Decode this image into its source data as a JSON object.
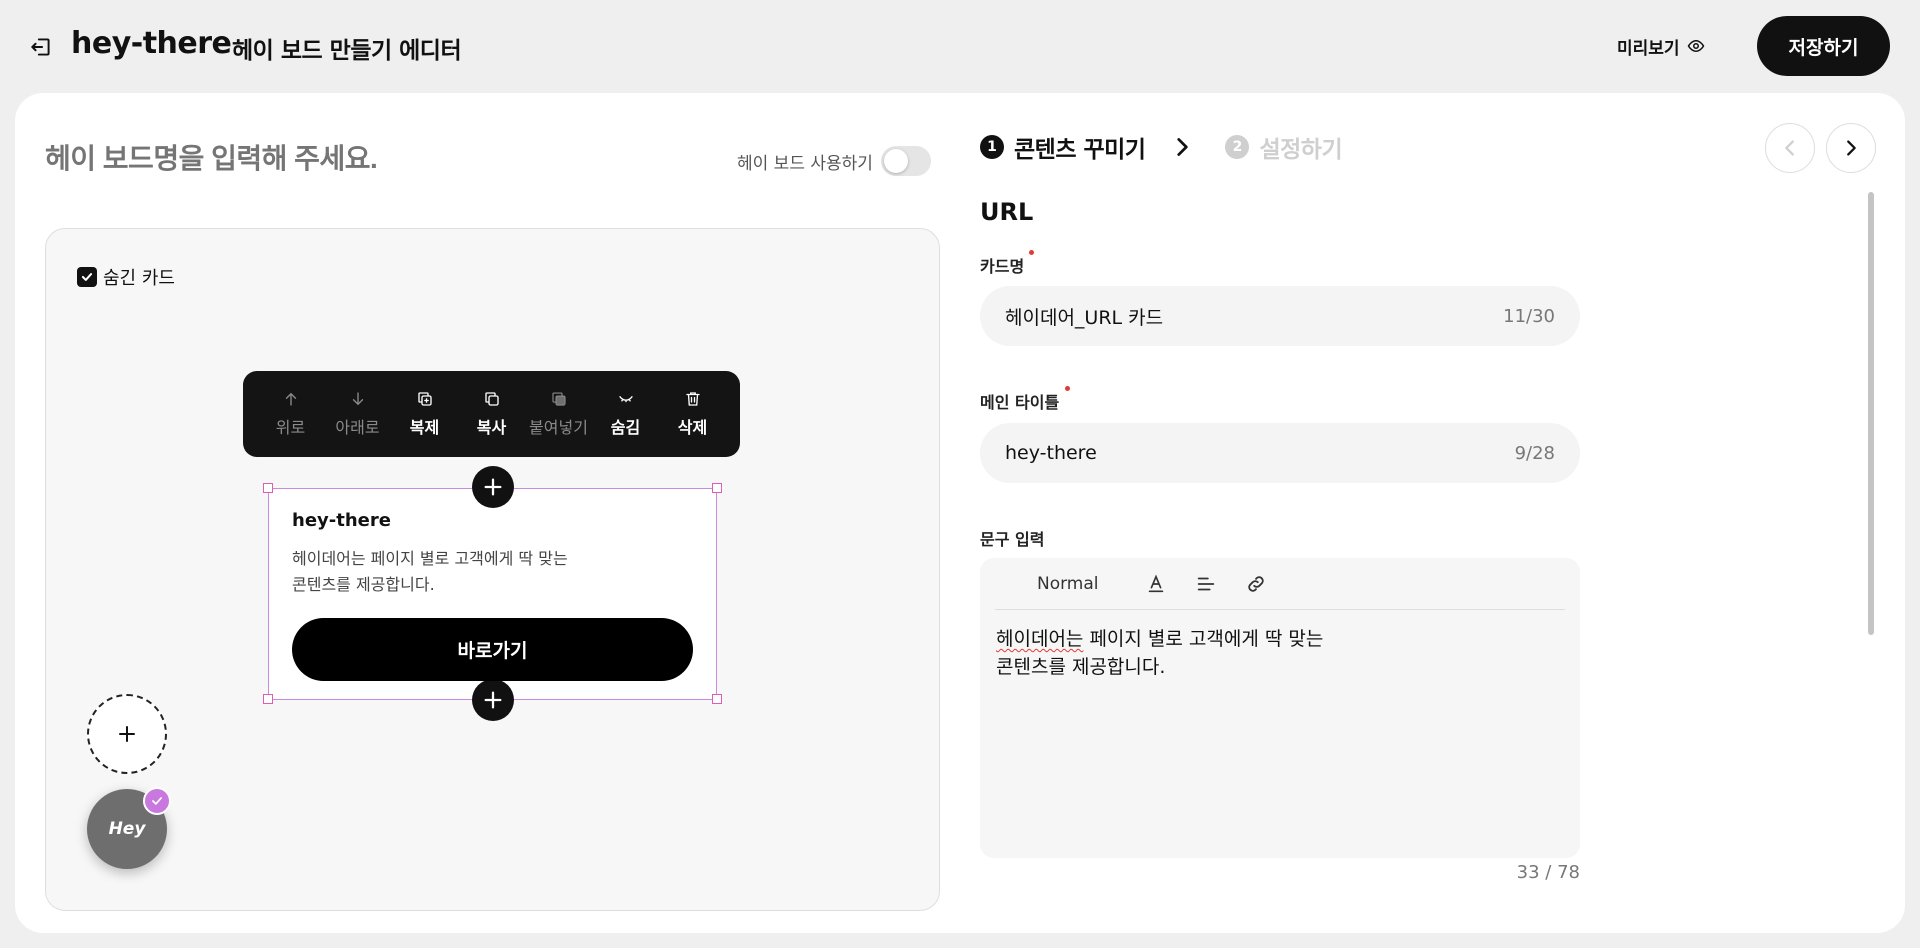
{
  "header": {
    "brand": "hey-there",
    "editor_title": "헤이 보드 만들기 에디터",
    "preview_label": "미리보기",
    "save_label": "저장하기"
  },
  "board": {
    "name_placeholder": "헤이 보드명을 입력해 주세요.",
    "use_label": "헤이 보드 사용하기",
    "use_enabled": false
  },
  "canvas": {
    "hidden_card_label": "숨긴 카드",
    "hidden_card_checked": true,
    "toolbar": [
      {
        "label": "위로",
        "icon": "arrow-up-icon",
        "enabled": false
      },
      {
        "label": "아래로",
        "icon": "arrow-down-icon",
        "enabled": false
      },
      {
        "label": "복제",
        "icon": "duplicate-icon",
        "enabled": true
      },
      {
        "label": "복사",
        "icon": "copy-icon",
        "enabled": true
      },
      {
        "label": "붙여넣기",
        "icon": "paste-icon",
        "enabled": false
      },
      {
        "label": "숨김",
        "icon": "eye-closed-icon",
        "enabled": true
      },
      {
        "label": "삭제",
        "icon": "trash-icon",
        "enabled": true
      }
    ],
    "card": {
      "title": "hey-there",
      "body": "헤이데어는 페이지 별로 고객에게 딱 맞는\n콘텐츠를 제공합니다.",
      "button_label": "바로가기"
    },
    "avatar_label": "Hey"
  },
  "steps": [
    {
      "number": "1",
      "label": "콘텐츠 꾸미기",
      "active": true
    },
    {
      "number": "2",
      "label": "설정하기",
      "active": false
    }
  ],
  "form": {
    "section_title": "URL",
    "card_name": {
      "label": "카드명",
      "value": "헤이데어_URL 카드",
      "count": "11/30"
    },
    "main_title": {
      "label": "메인 타이틀",
      "value": "hey-there",
      "count": "9/28"
    },
    "text_input": {
      "label": "문구 입력",
      "format": "Normal",
      "word_spellcheck": "헤이데어는",
      "rest_line1": " 페이지 별로 고객에게 딱 맞는",
      "line2": "콘텐츠를 제공합니다.",
      "count": "33 / 78"
    }
  },
  "colors": {
    "accent_dark": "#111111",
    "handle_pink": "#e05db2",
    "badge_purple": "#c978df",
    "required_red": "#e53935"
  }
}
